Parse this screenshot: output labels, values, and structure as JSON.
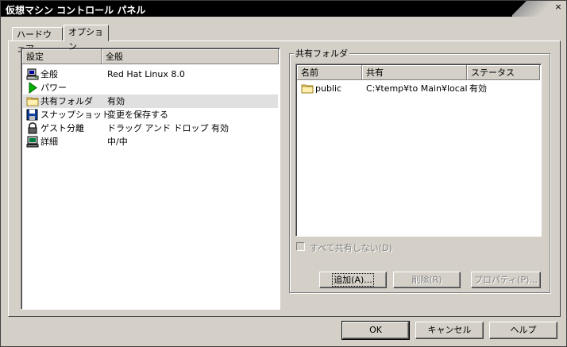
{
  "window": {
    "title": "仮想マシン コントロール パネル",
    "close_symbol": "×"
  },
  "tabs": [
    {
      "label": "ハードウェア"
    },
    {
      "label": "オプション"
    }
  ],
  "settings_list": {
    "columns": [
      "設定",
      "全般"
    ],
    "rows": [
      {
        "label": "全般",
        "value": "Red Hat Linux 8.0",
        "icon": "computer-icon"
      },
      {
        "label": "パワー",
        "value": "",
        "icon": "power-play-icon"
      },
      {
        "label": "共有フォルダ",
        "value": "有効",
        "icon": "folder-icon"
      },
      {
        "label": "スナップショット",
        "value": "変更を保存する",
        "icon": "floppy-disk-icon"
      },
      {
        "label": "ゲスト分離",
        "value": "ドラッグ アンド ドロップ 有効",
        "icon": "lock-icon"
      },
      {
        "label": "詳細",
        "value": "中/中",
        "icon": "advanced-computer-icon"
      }
    ],
    "selected_index": 2
  },
  "shared_folders": {
    "group_label": "共有フォルダ",
    "columns": [
      "名前",
      "共有",
      "ステータス"
    ],
    "rows": [
      {
        "name": "public",
        "path": "C:¥temp¥to Main¥local",
        "status": "有効"
      }
    ],
    "disable_all_label": "すべて共有しない(D)",
    "buttons": {
      "add": "追加(A)...",
      "remove": "削除(R)",
      "properties": "プロパティ(P)..."
    }
  },
  "footer": {
    "ok": "OK",
    "cancel": "キャンセル",
    "help": "ヘルプ"
  },
  "colors": {
    "titlebar": "#000000",
    "face": "#d4d0c8",
    "selected_row": "#e0e0e0",
    "list_bg": "#ffffff"
  }
}
